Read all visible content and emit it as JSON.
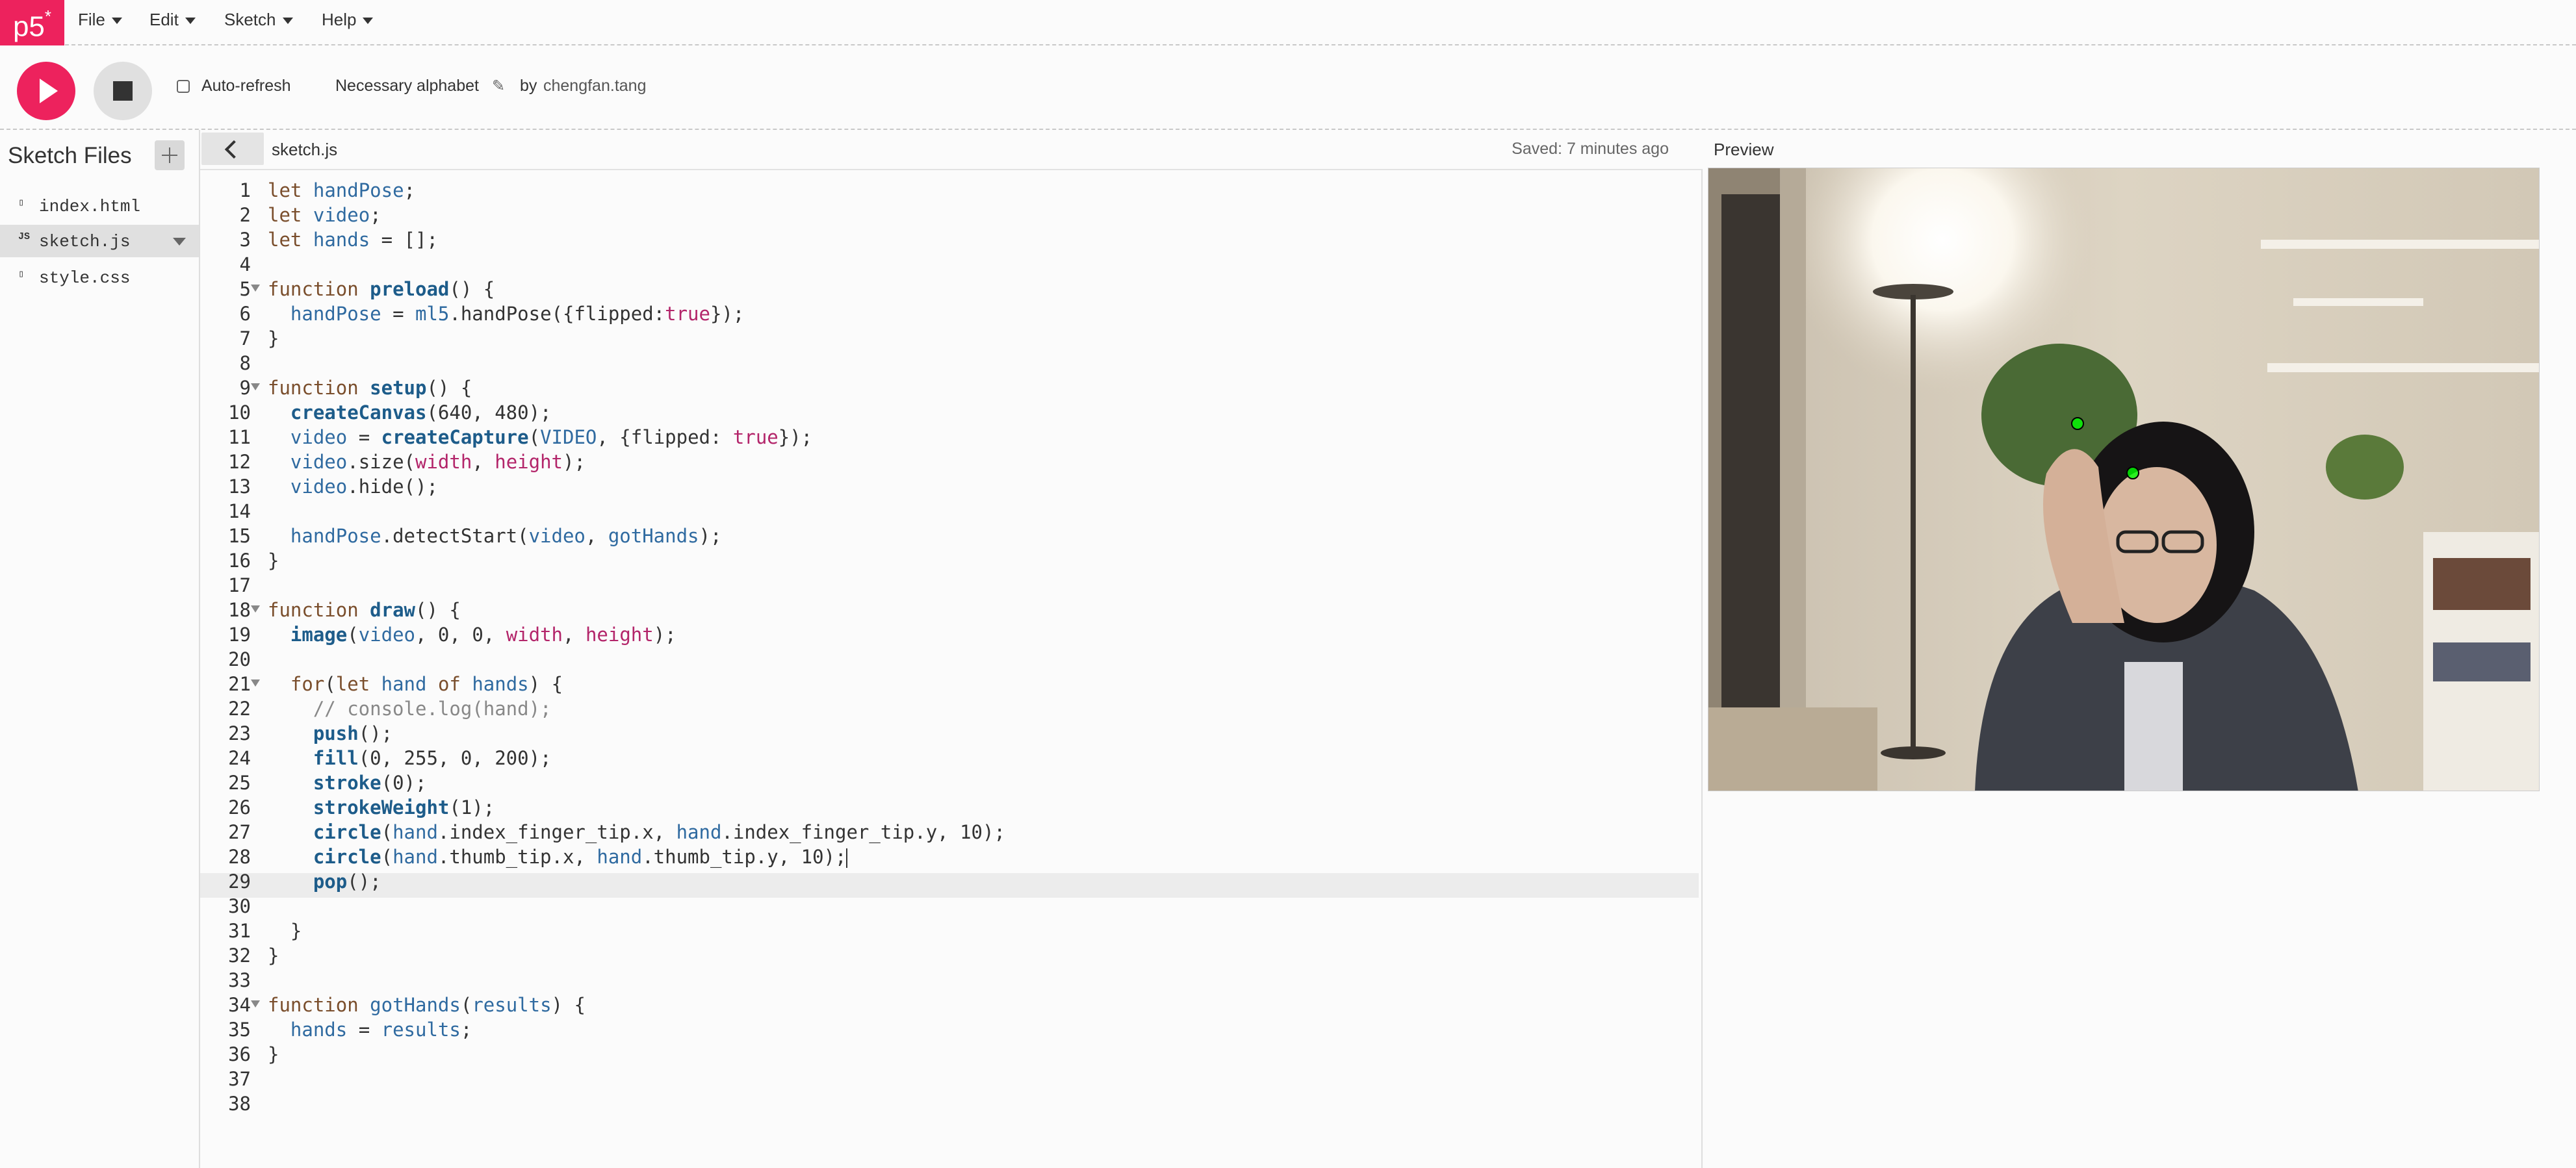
{
  "app": {
    "logo": "p5",
    "logo_sup": "*"
  },
  "menu": [
    {
      "label": "File"
    },
    {
      "label": "Edit"
    },
    {
      "label": "Sketch"
    },
    {
      "label": "Help"
    }
  ],
  "toolbar": {
    "auto_refresh_label": "Auto-refresh",
    "auto_refresh_checked": false,
    "project_name": "Necessary alphabet",
    "by_label": "by",
    "author": "chengfan.tang"
  },
  "sidebar": {
    "title": "Sketch Files",
    "files": [
      {
        "name": "index.html",
        "icon": "file-icon",
        "selected": false
      },
      {
        "name": "sketch.js",
        "icon": "js-file-icon",
        "icon_label": "JS",
        "selected": true
      },
      {
        "name": "style.css",
        "icon": "file-icon",
        "selected": false
      }
    ]
  },
  "editor": {
    "tab_name": "sketch.js",
    "saved_status": "Saved: 7 minutes ago",
    "active_line": 28,
    "lines": [
      "let handPose;",
      "let video;",
      "let hands = [];",
      "",
      "function preload() {",
      "  handPose = ml5.handPose({flipped:true});",
      "}",
      "",
      "function setup() {",
      "  createCanvas(640, 480);",
      "  video = createCapture(VIDEO, {flipped: true});",
      "  video.size(width, height);",
      "  video.hide();",
      "",
      "  handPose.detectStart(video, gotHands);",
      "}",
      "",
      "function draw() {",
      "  image(video, 0, 0, width, height);",
      "",
      "  for(let hand of hands) {",
      "    // console.log(hand);",
      "    push();",
      "    fill(0, 255, 0, 200);",
      "    stroke(0);",
      "    strokeWeight(1);",
      "    circle(hand.index_finger_tip.x, hand.index_finger_tip.y, 10);",
      "    circle(hand.thumb_tip.x, hand.thumb_tip.y, 10);",
      "    pop();",
      "",
      "  }",
      "}",
      "",
      "function gotHands(results) {",
      "  hands = results;",
      "}",
      "",
      ""
    ],
    "fold_lines": [
      5,
      9,
      18,
      21,
      34
    ]
  },
  "preview": {
    "label": "Preview",
    "image": "webcam-feed"
  },
  "colors": {
    "accent": "#ed225d",
    "keyword": "#7a4e2c",
    "builtin_function": "#1d5c8a",
    "variable": "#2f6aa0",
    "boolean_constant": "#b3256a",
    "comment": "#888888"
  }
}
